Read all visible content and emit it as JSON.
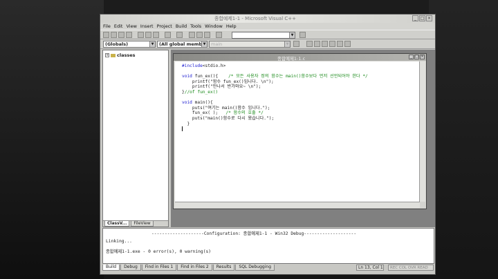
{
  "window": {
    "title": "종합예제1-1 - Microsoft Visual C++",
    "buttons": {
      "minimize": "_",
      "maximize": "□",
      "close": "×"
    }
  },
  "menu": [
    "File",
    "Edit",
    "View",
    "Insert",
    "Project",
    "Build",
    "Tools",
    "Window",
    "Help"
  ],
  "wizard_bar": {
    "class_combo": "(Globals)",
    "members_combo": "(All global members)",
    "function_combo": "main"
  },
  "workspace": {
    "tree_root": "classes",
    "tabs": [
      "ClassV...",
      "FileView"
    ]
  },
  "editor": {
    "title": "종합예제1-1.c",
    "lines": [
      {
        "kw": "#include",
        "text": "<stdio.h>",
        "cm": ""
      },
      {
        "kw": "",
        "text": "",
        "cm": ""
      },
      {
        "kw": "void",
        "text": " fun_ex(){    ",
        "cm": "/* 모든 사용자 정의 함수는 main()함수보다 먼저 선언되어야 한다 */"
      },
      {
        "kw": "",
        "text": "    printf(\"함수 fun_ex()입니다. \\n\");",
        "cm": ""
      },
      {
        "kw": "",
        "text": "    printf(\"만나서 반가와요~ \\n\");",
        "cm": ""
      },
      {
        "kw": "",
        "text": "}",
        "cm": "//of fun_ex()"
      },
      {
        "kw": "",
        "text": "",
        "cm": ""
      },
      {
        "kw": "void",
        "text": " main(){",
        "cm": ""
      },
      {
        "kw": "",
        "text": "    puts(\"여기는 main()함수 입니다.\");",
        "cm": ""
      },
      {
        "kw": "",
        "text": "    fun_ex( );   ",
        "cm": "/* 함수의 호출 */"
      },
      {
        "kw": "",
        "text": "    puts(\"main()함수로 다시 왔습니다.\");",
        "cm": ""
      },
      {
        "kw": "",
        "text": "  }",
        "cm": ""
      }
    ]
  },
  "output": {
    "configuration": "--------------------Configuration: 종합예제1-1 - Win32 Debug--------------------",
    "linking": "Linking...",
    "result": "종합예제1-1.exe - 0 error(s), 0 warning(s)",
    "tabs": [
      "Build",
      "Debug",
      "Find in Files 1",
      "Find in Files 2",
      "Results",
      "SQL Debugging"
    ]
  },
  "status": {
    "position": "Ln 13, Col 1",
    "flags": "REC COL OVR READ"
  }
}
